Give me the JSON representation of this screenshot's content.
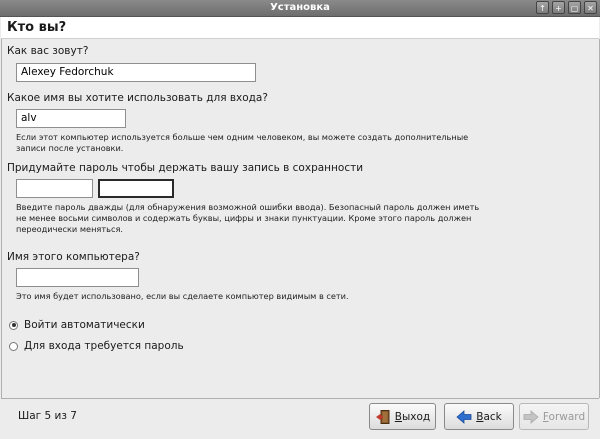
{
  "window": {
    "title": "Установка",
    "buttons": [
      "↑",
      "+",
      "▢",
      "✕"
    ]
  },
  "header": {
    "title": "Кто вы?"
  },
  "form": {
    "name_label": "Как вас зовут?",
    "name_value": "Alexey Fedorchuk",
    "login_label": "Какое имя вы хотите использовать для входа?",
    "login_value": "alv",
    "login_hint_1": "Если этот компьютер используется больше чем одним человеком, вы можете создать дополнительные",
    "login_hint_2": "записи после установки.",
    "password_label": "Придумайте пароль чтобы держать вашу запись в сохранности",
    "password_value": "",
    "password_confirm_value": "",
    "password_hint_1": "Введите пароль дважды  (для обнаружения возможной ошибки ввода). Безопасный пароль должен иметь",
    "password_hint_2": "не менее восьми символов и содержать буквы, цифры и знаки пунктуации. Кроме этого пароль должен",
    "password_hint_3": "переодически меняться.",
    "hostname_label": "Имя этого компьютера?",
    "hostname_value": "",
    "hostname_hint": "Это имя будет использовано, если вы сделаете компьютер видимым в сети.",
    "login_options": [
      {
        "label": "Войти автоматически",
        "checked": true
      },
      {
        "label": "Для входа требуется пароль",
        "checked": false
      }
    ]
  },
  "footer": {
    "step": "Шаг 5 из 7",
    "quit_label_first": "В",
    "quit_label_rest": "ыход",
    "back_label_first": "B",
    "back_label_rest": "ack",
    "forward_label_first": "F",
    "forward_label_rest": "orward"
  },
  "colors": {
    "titlebar": "#7a7a7a",
    "background": "#ececec",
    "accent_blue": "#2f6fd0",
    "exit_red": "#c0392b"
  },
  "icons": [
    "arrow-up-icon",
    "plus-icon",
    "maximize-icon",
    "close-icon",
    "exit-door-icon",
    "back-arrow-icon",
    "forward-arrow-icon"
  ]
}
